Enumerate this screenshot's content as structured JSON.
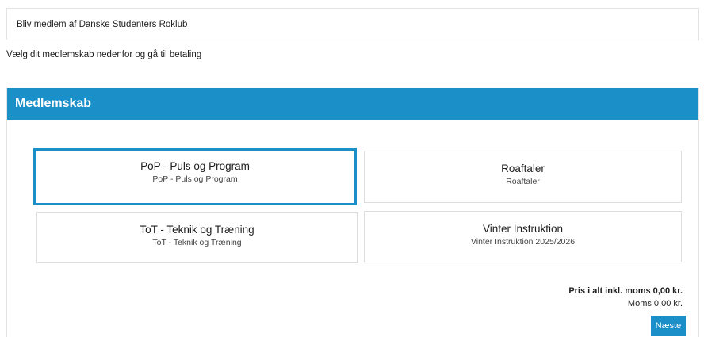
{
  "header": {
    "title": "Bliv medlem af Danske Studenters Roklub",
    "instruction": "Vælg dit medlemskab nedenfor og gå til betaling"
  },
  "panel": {
    "heading": "Medlemskab",
    "options": [
      {
        "title": "PoP - Puls og Program",
        "subtitle": "PoP - Puls og Program",
        "selected": true
      },
      {
        "title": "Roaftaler",
        "subtitle": "Roaftaler",
        "selected": false
      },
      {
        "title": "ToT - Teknik og Træning",
        "subtitle": "ToT - Teknik og Træning",
        "selected": false
      },
      {
        "title": "Vinter Instruktion",
        "subtitle": "Vinter Instruktion 2025/2026",
        "selected": false
      }
    ]
  },
  "totals": {
    "total_label": "Pris i alt inkl. moms 0,00 kr.",
    "vat_label": "Moms 0,00 kr."
  },
  "actions": {
    "next_label": "Næste"
  },
  "colors": {
    "accent": "#1a8fc8",
    "card_border": "#dddddd"
  }
}
